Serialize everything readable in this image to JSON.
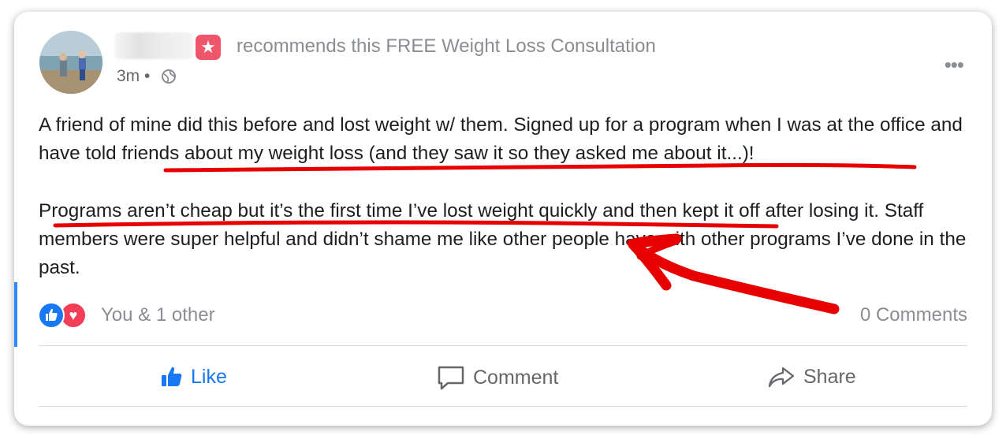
{
  "post": {
    "headline": "recommends this FREE Weight Loss Consultation",
    "time": "3m",
    "separator": "•",
    "paragraph1": "A friend of mine did this before and lost weight w/ them. Signed up for a program when I was at the office and have told friends about my weight loss (and they saw it so they asked me about it...)!",
    "paragraph2": "Programs aren’t cheap but it’s the first time I’ve lost weight quickly and then kept it off after losing it.  Staff members were super helpful and didn’t shame me like other people have with other programs I’ve done in the past."
  },
  "reactions": {
    "summary": "You & 1 other",
    "comments": "0 Comments",
    "icons": [
      "thumbs-up-icon",
      "heart-icon"
    ]
  },
  "actions": {
    "like": "Like",
    "comment": "Comment",
    "share": "Share"
  },
  "colors": {
    "brand_blue": "#1877f2",
    "love_red": "#f33e58",
    "annotation_red": "#e60000",
    "muted_text": "#8a8d91",
    "accent_bar": "#2d88ff"
  }
}
